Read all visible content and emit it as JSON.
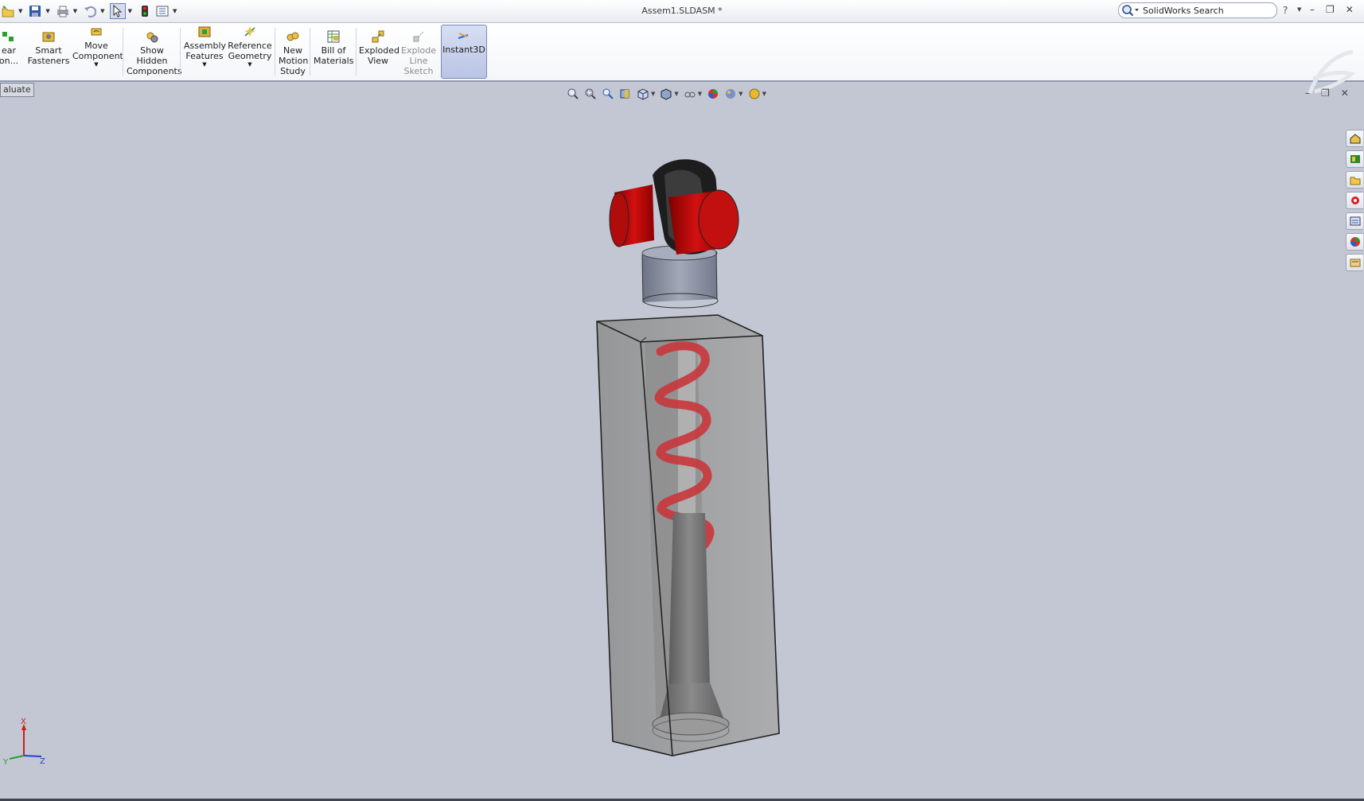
{
  "window": {
    "title": "Assem1.SLDASM *",
    "search_placeholder": "SolidWorks Search",
    "help_label": "?"
  },
  "ribbon": {
    "items": [
      {
        "label_line1": "ear",
        "label_line2": "on..."
      },
      {
        "label_line1": "Smart",
        "label_line2": "Fasteners"
      },
      {
        "label_line1": "Move",
        "label_line2": "Component"
      },
      {
        "label_line1": "Show",
        "label_line2": "Hidden",
        "label_line3": "Components"
      },
      {
        "label_line1": "Assembly",
        "label_line2": "Features"
      },
      {
        "label_line1": "Reference",
        "label_line2": "Geometry"
      },
      {
        "label_line1": "New",
        "label_line2": "Motion",
        "label_line3": "Study"
      },
      {
        "label_line1": "Bill of",
        "label_line2": "Materials"
      },
      {
        "label_line1": "Exploded",
        "label_line2": "View"
      },
      {
        "label_line1": "Explode",
        "label_line2": "Line",
        "label_line3": "Sketch"
      },
      {
        "label_line1": "Instant3D"
      }
    ]
  },
  "command_tab": {
    "evaluate_label": "aluate"
  },
  "colors": {
    "viewport_bg": "#c3c7d3",
    "spring_red": "#c8383c",
    "knob_red": "#c41010",
    "accent": "#7c8ab8"
  },
  "icons": {
    "qat": [
      "open-icon",
      "save-icon",
      "print-icon",
      "undo-icon",
      "select-icon",
      "rebuild-icon",
      "options-icon"
    ],
    "view": [
      "zoom-to-fit-icon",
      "zoom-area-icon",
      "previous-view-icon",
      "section-view-icon",
      "view-orientation-icon",
      "display-style-icon",
      "hide-show-icon",
      "edit-appearance-icon",
      "apply-scene-icon",
      "view-settings-icon"
    ],
    "taskpane": [
      "resources-home-icon",
      "design-library-icon",
      "file-explorer-icon",
      "search-3d-icon",
      "view-palette-icon",
      "appearances-icon",
      "custom-properties-icon"
    ]
  },
  "triad": {
    "x_label": "X",
    "y_label": "Y",
    "z_label": "Z"
  }
}
